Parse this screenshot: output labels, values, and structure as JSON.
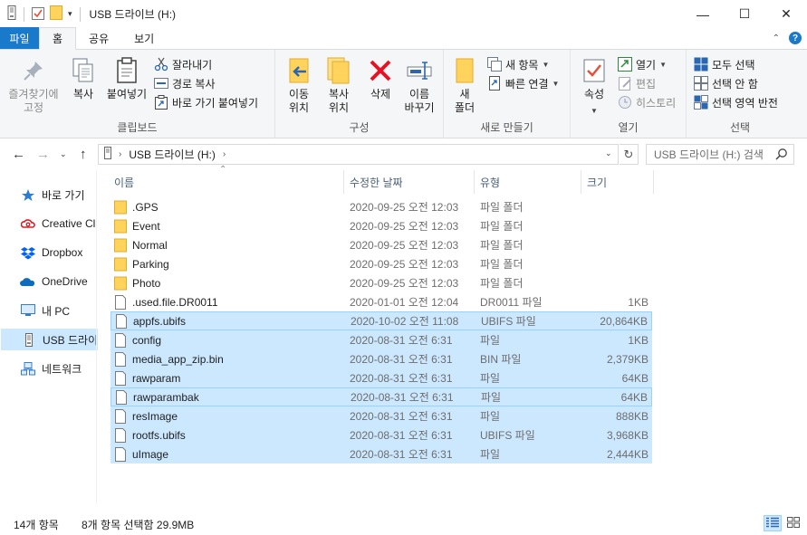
{
  "window": {
    "title": "USB 드라이브 (H:)",
    "minimize": "—",
    "maximize": "☐",
    "close": "✕"
  },
  "ribbon_tabs": [
    "파일",
    "홈",
    "공유",
    "보기"
  ],
  "ribbon": {
    "clipboard": {
      "pin": "즐겨찾기에\n고정",
      "copy": "복사",
      "paste": "붙여넣기",
      "cut": "잘라내기",
      "copy_path": "경로 복사",
      "paste_shortcut": "바로 가기 붙여넣기",
      "label": "클립보드"
    },
    "organize": {
      "move_to": "이동\n위치",
      "copy_to": "복사\n위치",
      "delete": "삭제",
      "rename": "이름\n바꾸기",
      "label": "구성"
    },
    "new": {
      "new_folder": "새\n폴더",
      "new_item": "새 항목",
      "easy_access": "빠른 연결",
      "label": "새로 만들기"
    },
    "open": {
      "properties": "속성",
      "open": "열기",
      "edit": "편집",
      "history": "히스토리",
      "label": "열기"
    },
    "select": {
      "select_all": "모두 선택",
      "select_none": "선택 안 함",
      "invert": "선택 영역 반전",
      "label": "선택"
    }
  },
  "address": {
    "path": "USB 드라이브 (H:)",
    "search_placeholder": "USB 드라이브 (H:) 검색"
  },
  "nav_pane": [
    {
      "label": "바로 가기",
      "icon": "star-icon",
      "selected": false
    },
    {
      "label": "Creative Cl",
      "icon": "creative-cloud-icon",
      "selected": false
    },
    {
      "label": "Dropbox",
      "icon": "dropbox-icon",
      "selected": false
    },
    {
      "label": "OneDrive",
      "icon": "onedrive-icon",
      "selected": false
    },
    {
      "label": "내 PC",
      "icon": "pc-icon",
      "selected": false
    },
    {
      "label": "USB 드라이브",
      "icon": "usb-drive-icon",
      "selected": true
    },
    {
      "label": "네트워크",
      "icon": "network-icon",
      "selected": false
    }
  ],
  "columns": {
    "name": "이름",
    "date": "수정한 날짜",
    "type": "유형",
    "size": "크기"
  },
  "files": [
    {
      "name": ".GPS",
      "date": "2020-09-25 오전 12:03",
      "type": "파일 폴더",
      "size": "",
      "kind": "folder",
      "selected": false
    },
    {
      "name": "Event",
      "date": "2020-09-25 오전 12:03",
      "type": "파일 폴더",
      "size": "",
      "kind": "folder",
      "selected": false
    },
    {
      "name": "Normal",
      "date": "2020-09-25 오전 12:03",
      "type": "파일 폴더",
      "size": "",
      "kind": "folder",
      "selected": false
    },
    {
      "name": "Parking",
      "date": "2020-09-25 오전 12:03",
      "type": "파일 폴더",
      "size": "",
      "kind": "folder",
      "selected": false
    },
    {
      "name": "Photo",
      "date": "2020-09-25 오전 12:03",
      "type": "파일 폴더",
      "size": "",
      "kind": "folder",
      "selected": false
    },
    {
      "name": ".used.file.DR0011",
      "date": "2020-01-01 오전 12:04",
      "type": "DR0011 파일",
      "size": "1KB",
      "kind": "file",
      "selected": false
    },
    {
      "name": "appfs.ubifs",
      "date": "2020-10-02 오전 11:08",
      "type": "UBIFS 파일",
      "size": "20,864KB",
      "kind": "file",
      "selected": true
    },
    {
      "name": "config",
      "date": "2020-08-31 오전 6:31",
      "type": "파일",
      "size": "1KB",
      "kind": "file",
      "selected": true
    },
    {
      "name": "media_app_zip.bin",
      "date": "2020-08-31 오전 6:31",
      "type": "BIN 파일",
      "size": "2,379KB",
      "kind": "file",
      "selected": true
    },
    {
      "name": "rawparam",
      "date": "2020-08-31 오전 6:31",
      "type": "파일",
      "size": "64KB",
      "kind": "file",
      "selected": true
    },
    {
      "name": "rawparambak",
      "date": "2020-08-31 오전 6:31",
      "type": "파일",
      "size": "64KB",
      "kind": "file",
      "selected": true
    },
    {
      "name": "resImage",
      "date": "2020-08-31 오전 6:31",
      "type": "파일",
      "size": "888KB",
      "kind": "file",
      "selected": true
    },
    {
      "name": "rootfs.ubifs",
      "date": "2020-08-31 오전 6:31",
      "type": "UBIFS 파일",
      "size": "3,968KB",
      "kind": "file",
      "selected": true
    },
    {
      "name": "uImage",
      "date": "2020-08-31 오전 6:31",
      "type": "파일",
      "size": "2,444KB",
      "kind": "file",
      "selected": true
    }
  ],
  "status": {
    "item_count": "14개 항목",
    "selection": "8개 항목 선택함 29.9MB"
  },
  "colors": {
    "file_tab": "#1979ca",
    "selection": "#cce8ff",
    "selection_border": "#99d1ff",
    "folder": "#ffd35c",
    "delete_red": "#e81123"
  }
}
